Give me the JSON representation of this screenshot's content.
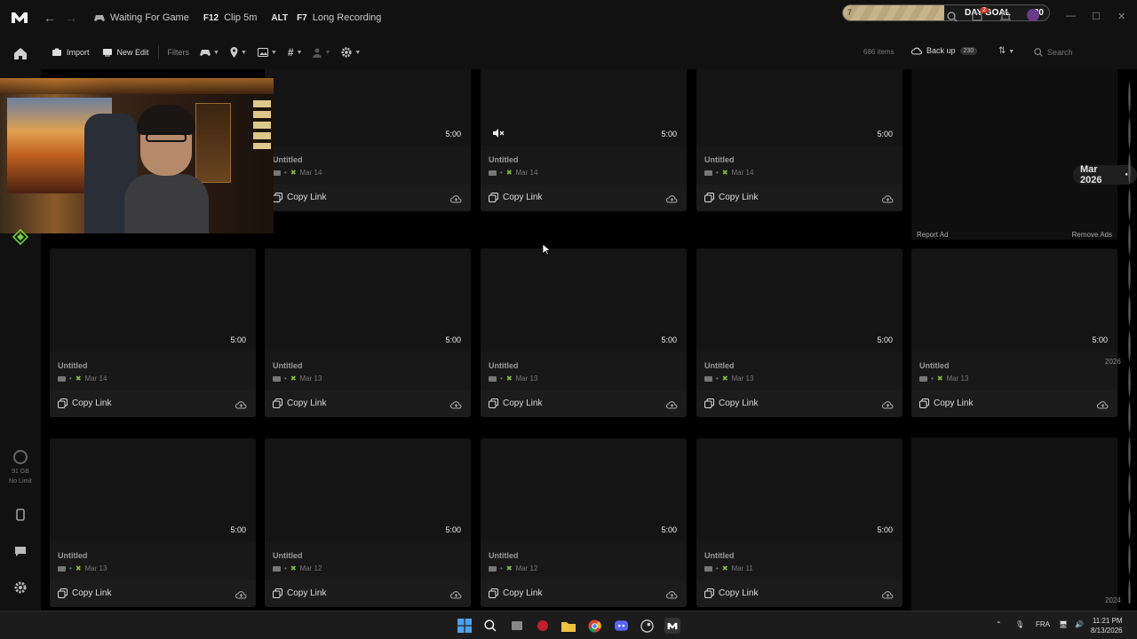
{
  "titlebar": {
    "status": "Waiting For Game",
    "hotkeys": [
      {
        "key": "F12",
        "label": "Clip 5m"
      },
      {
        "key": "ALT",
        "label": ""
      },
      {
        "key": "F7",
        "label": "Long Recording"
      }
    ],
    "day_goal": {
      "label": "DAY GOAL",
      "current": "7",
      "target": "20",
      "progress": 0.49,
      "bubble_count": "2"
    }
  },
  "toolbar": {
    "import_label": "Import",
    "new_edit_label": "New Edit",
    "filters_label": "Filters",
    "items_count": "686 items",
    "backup_label": "Back up",
    "backup_badge": "230",
    "search_placeholder": "Search"
  },
  "rail": {
    "storage_size": "91 GB",
    "storage_limit": "No Limit"
  },
  "grid": {
    "copy_link_label": "Copy Link",
    "rows": [
      [
        {
          "title": "Untitled",
          "date": "Mar 14",
          "duration": "5:00",
          "muted": false
        },
        {
          "title": "Untitled",
          "date": "Mar 14",
          "duration": "5:00",
          "muted": true
        },
        {
          "title": "Untitled",
          "date": "Mar 14",
          "duration": "5:00",
          "muted": false
        }
      ],
      [
        {
          "title": "Untitled",
          "date": "Mar 14",
          "duration": "5:00"
        },
        {
          "title": "Untitled",
          "date": "Mar 13",
          "duration": "5:00"
        },
        {
          "title": "Untitled",
          "date": "Mar 13",
          "duration": "5:00"
        },
        {
          "title": "Untitled",
          "date": "Mar 13",
          "duration": "5:00"
        },
        {
          "title": "Untitled",
          "date": "Mar 13",
          "duration": "5:00"
        }
      ],
      [
        {
          "title": "Untitled",
          "date": "Mar 13",
          "duration": "5:00"
        },
        {
          "title": "Untitled",
          "date": "Mar 12",
          "duration": "5:00"
        },
        {
          "title": "Untitled",
          "date": "Mar 12",
          "duration": "5:00"
        },
        {
          "title": "Untitled",
          "date": "Mar 11",
          "duration": "5:00"
        }
      ]
    ],
    "ad": {
      "report_label": "Report Ad",
      "remove_label": "Remove Ads"
    },
    "date_pill": "Mar 2026",
    "year_marks": [
      "2026",
      "2024"
    ]
  },
  "taskbar": {
    "language": "FRA",
    "time": "11:21 PM",
    "date": "8/13/2026"
  },
  "colors": {
    "accent_green": "#7fbf3f",
    "goal_fill": "#c7b48a",
    "background": "#000000",
    "card": "#181818"
  }
}
